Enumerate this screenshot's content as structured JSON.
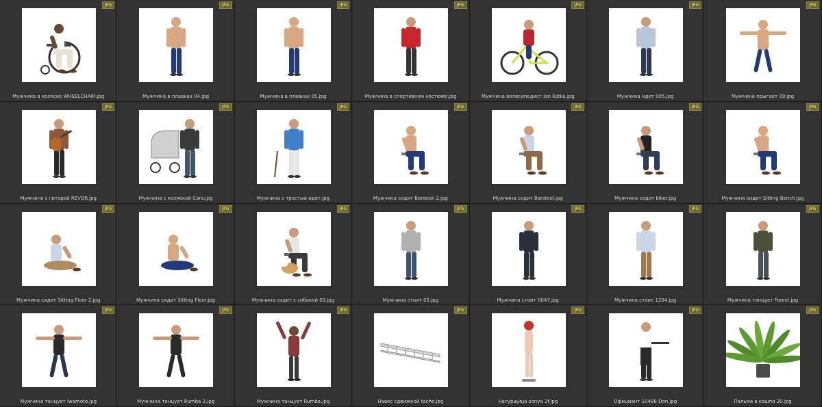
{
  "badge_label": "JPG",
  "colors": {
    "background": "#2b2b2b",
    "cell_bg": "#323232",
    "badge_bg": "#6d6a2c",
    "caption": "#d4d4d4"
  },
  "items": [
    {
      "name": "Мужчина в коляске WHEELCHAIR.jpg",
      "icon": "wheelchair-man",
      "shirt": "#ffffff",
      "pants": "#e8e2d6",
      "skin": "#6b4a35"
    },
    {
      "name": "Мужчина в плавках 04.jpg",
      "icon": "swimsuit-man",
      "shirt": "#d8a782",
      "pants": "#233a78",
      "skin": "#d8a782"
    },
    {
      "name": "Мужчина в плавках 05.jpg",
      "icon": "swimsuit-man",
      "shirt": "#d8a782",
      "pants": "#233a78",
      "skin": "#d8a782"
    },
    {
      "name": "Мужчина в спортивном костюме.jpg",
      "icon": "tracksuit-man",
      "shirt": "#c8262c",
      "pants": "#333333",
      "skin": "#c99b7a"
    },
    {
      "name": "Мужчина велосипедист Ian Kotka.jpg",
      "icon": "cyclist-man",
      "shirt": "#b82830",
      "pants": "#1d3b7a",
      "skin": "#c99b7a"
    },
    {
      "name": "Мужчина идет 905.jpg",
      "icon": "walking-man",
      "shirt": "#b8c6d8",
      "pants": "#2c3a55",
      "skin": "#c99b7a"
    },
    {
      "name": "Мужчина прыгает 09.jpg",
      "icon": "jumping-man",
      "shirt": "#d8a782",
      "pants": "#233a78",
      "skin": "#d8a782"
    },
    {
      "name": "Мужчина с гитарой REVOR.jpg",
      "icon": "guitar-man",
      "shirt": "#8a5a3a",
      "pants": "#2a2a2a",
      "skin": "#c99b7a"
    },
    {
      "name": "Мужчина с коляской Cara.jpg",
      "icon": "stroller-man",
      "shirt": "#3a3a3a",
      "pants": "#445566",
      "skin": "#c99b7a"
    },
    {
      "name": "Мужчина с тростью идет.jpg",
      "icon": "cane-man",
      "shirt": "#3f7fc8",
      "pants": "#e6e6e6",
      "skin": "#c99b7a"
    },
    {
      "name": "Мужчина сидит Barstool 2.jpg",
      "icon": "sitting-man",
      "shirt": "#d8a782",
      "pants": "#233a78",
      "skin": "#d8a782"
    },
    {
      "name": "Мужчина сидит Barstool.jpg",
      "icon": "sitting-man",
      "shirt": "#c8d6e8",
      "pants": "#8a6a48",
      "skin": "#c99b7a"
    },
    {
      "name": "Мужчина сидит biker.jpg",
      "icon": "sitting-man",
      "shirt": "#222222",
      "pants": "#2f3d55",
      "skin": "#c99b7a"
    },
    {
      "name": "Мужчина сидит Sitting Bench.jpg",
      "icon": "sitting-man",
      "shirt": "#d8a782",
      "pants": "#233a78",
      "skin": "#d8a782"
    },
    {
      "name": "Мужчина сидит Sitting Floor 2.jpg",
      "icon": "floor-sitting-man",
      "shirt": "#c8d6e8",
      "pants": "#b08a60",
      "skin": "#c99b7a"
    },
    {
      "name": "Мужчина сидит Sitting Floor.jpg",
      "icon": "floor-sitting-man",
      "shirt": "#d8a782",
      "pants": "#233a78",
      "skin": "#d8a782"
    },
    {
      "name": "Мужчина сидит с собакой 03.jpg",
      "icon": "dog-man",
      "shirt": "#e6e6e6",
      "pants": "#3a3a3a",
      "skin": "#c99b7a"
    },
    {
      "name": "Мужчина стоит 05.jpg",
      "icon": "standing-man",
      "shirt": "#b0b0b0",
      "pants": "#3b5578",
      "skin": "#c99b7a"
    },
    {
      "name": "Мужчина стоит 0047.jpg",
      "icon": "standing-man",
      "shirt": "#2a2f3a",
      "pants": "#2a2f3a",
      "skin": "#c99b7a"
    },
    {
      "name": "Мужчина стоит 1204.jpg",
      "icon": "standing-man",
      "shirt": "#c8d6e8",
      "pants": "#a07850",
      "skin": "#c99b7a"
    },
    {
      "name": "Мужчина танцует Forest.jpg",
      "icon": "standing-man",
      "shirt": "#4a5038",
      "pants": "#4a5058",
      "skin": "#c99b7a"
    },
    {
      "name": "Мужчина танцует Iwamoto.jpg",
      "icon": "dancing-man",
      "shirt": "#2a2a2a",
      "pants": "#2a3550",
      "skin": "#c99b7a"
    },
    {
      "name": "Мужчина танцует Rumba 2.jpg",
      "icon": "dancing-man",
      "shirt": "#2a2a2a",
      "pants": "#2a2a2a",
      "skin": "#c99b7a"
    },
    {
      "name": "Мужчина танцует Rumba.jpg",
      "icon": "arms-up-man",
      "shirt": "#8a3a3a",
      "pants": "#3a3a3a",
      "skin": "#6b4a35"
    },
    {
      "name": "Навес сдвижной techo.jpg",
      "icon": "sliding-canopy",
      "shirt": "#c8c8c8",
      "pants": "#a0a0a0",
      "skin": "#ffffff"
    },
    {
      "name": "Натурщица sonya 2f.jpg",
      "icon": "model-woman",
      "shirt": "#f0c8b8",
      "pants": "#f0c8b8",
      "skin": "#f0c8b8"
    },
    {
      "name": "Официант 10488 Don.jpg",
      "icon": "waiter",
      "shirt": "#ffffff",
      "pants": "#2a2a2a",
      "skin": "#c99b7a"
    },
    {
      "name": "Пальма в кашпо 30.jpg",
      "icon": "potted-palm",
      "shirt": "#5a8a30",
      "pants": "#555555",
      "skin": "#ffffff"
    }
  ]
}
